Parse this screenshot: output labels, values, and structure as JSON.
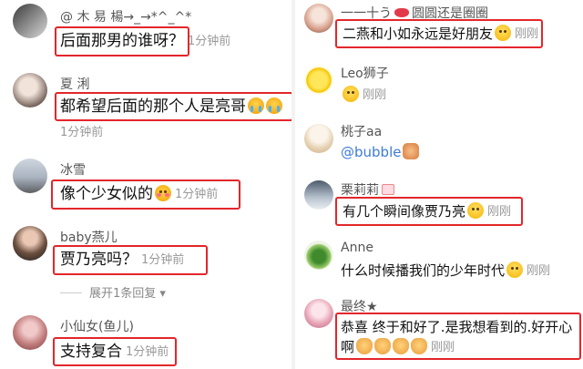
{
  "left": {
    "comments": [
      {
        "user": "@ 木 易 楊→_→*^_^*",
        "text": "后面那男的谁呀？",
        "time": "1分钟前"
      },
      {
        "user": "夏 浰",
        "text": "都希望后面的那个人是亮哥",
        "time": "1分钟前"
      },
      {
        "user": "冰雪",
        "text": "像个少女似的",
        "time": "1分钟前"
      },
      {
        "user": "baby燕儿",
        "text": "贾乃亮吗？",
        "time": "1分钟前"
      },
      {
        "user": "小仙女(鱼儿)",
        "text": "支持复合",
        "time": "1分钟前"
      }
    ],
    "expand_replies": "展开1条回复"
  },
  "right": {
    "comments": [
      {
        "user_a": "一一十う",
        "user_b": "圆圆还是圈圈",
        "text": "二燕和小如永远是好朋友",
        "time": "刚刚"
      },
      {
        "user": "Leo狮子",
        "text": "",
        "time": "刚刚"
      },
      {
        "user": "桃子aa",
        "text": "@bubble",
        "time": ""
      },
      {
        "user": "栗莉莉",
        "text": "有几个瞬间像贾乃亮",
        "time": "刚刚"
      },
      {
        "user": "Anne",
        "text": "什么时候播我们的少年时代",
        "time": "刚刚"
      },
      {
        "user": "最终★",
        "text": "恭喜 终于和好了.是我想看到的.好开心",
        "text2": "啊",
        "time": "刚刚"
      }
    ]
  },
  "colors": {
    "highlight": "#e3262b",
    "mention": "#3d7bd6",
    "time": "#999999"
  }
}
